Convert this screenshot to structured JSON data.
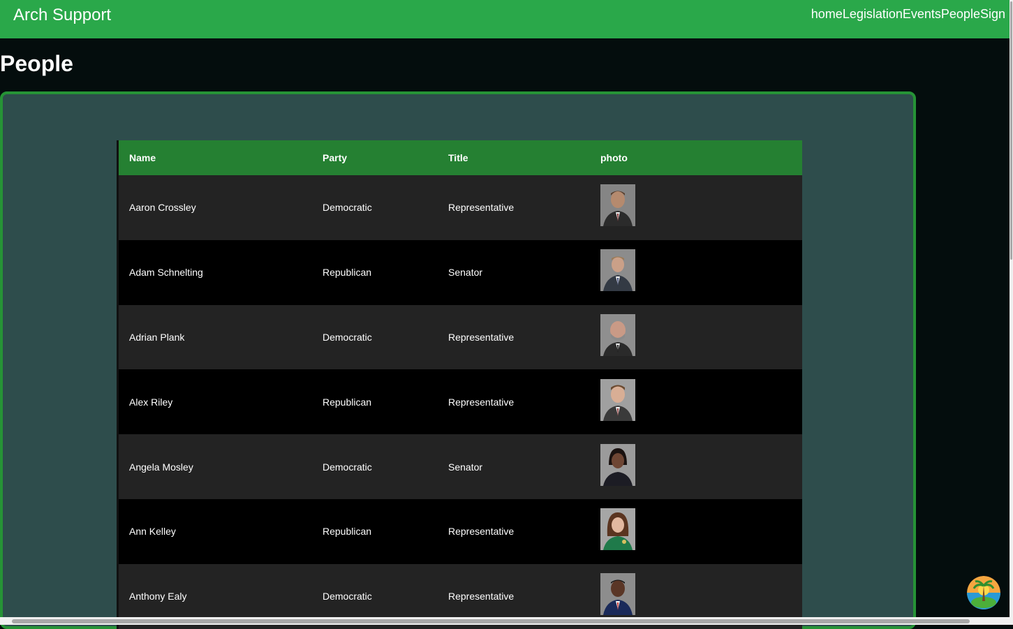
{
  "header": {
    "brand": "Arch Support",
    "nav": [
      "home",
      "Legislation",
      "Events",
      "People",
      "Sign"
    ]
  },
  "page": {
    "title": "People"
  },
  "table": {
    "columns": [
      "Name",
      "Party",
      "Title",
      "photo"
    ],
    "rows": [
      {
        "name": "Aaron Crossley",
        "party": "Democratic",
        "title": "Representative"
      },
      {
        "name": "Adam Schnelting",
        "party": "Republican",
        "title": "Senator"
      },
      {
        "name": "Adrian Plank",
        "party": "Democratic",
        "title": "Representative"
      },
      {
        "name": "Alex Riley",
        "party": "Republican",
        "title": "Representative"
      },
      {
        "name": "Angela Mosley",
        "party": "Democratic",
        "title": "Senator"
      },
      {
        "name": "Ann Kelley",
        "party": "Republican",
        "title": "Representative"
      },
      {
        "name": "Anthony Ealy",
        "party": "Democratic",
        "title": "Representative"
      }
    ]
  },
  "colors": {
    "nav_bg": "#2aa84a",
    "page_bg": "#040d0d",
    "panel_bg": "#2e4d4c",
    "panel_border": "#269336",
    "table_header_bg": "#258032"
  }
}
